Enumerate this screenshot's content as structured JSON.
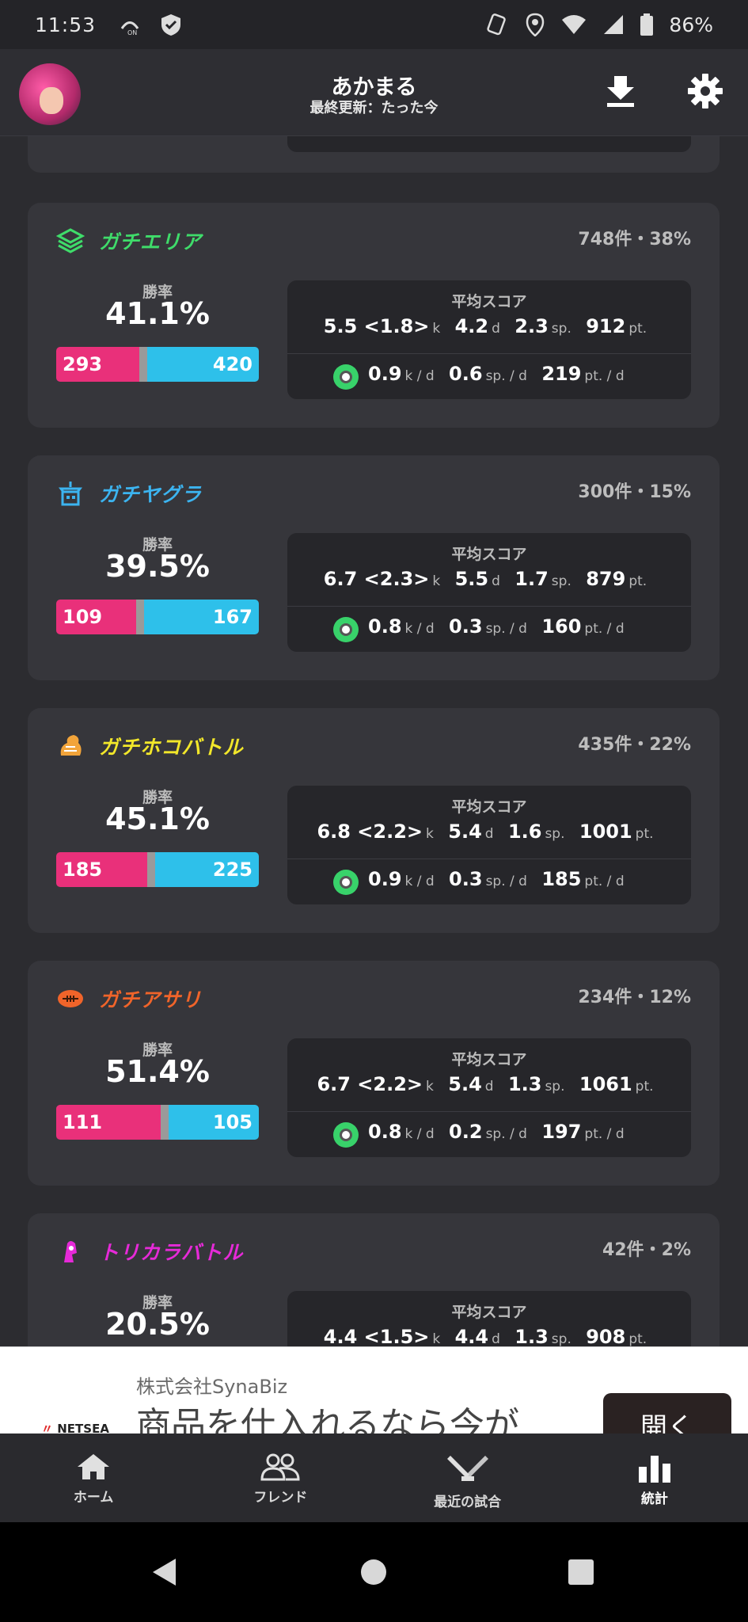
{
  "status_bar": {
    "time": "11:53",
    "battery": "86%"
  },
  "header": {
    "title": "あかまる",
    "subtitle": "最終更新：たった今"
  },
  "modes": [
    {
      "name": "ガチエリア",
      "color": "#3fdc6a",
      "count": "748件・38%",
      "win_rate_label": "勝率",
      "win_rate": "41.1%",
      "wins": "293",
      "losses": "420",
      "win_fraction": 0.411,
      "score_label": "平均スコア",
      "kill": "5.5 <1.8>",
      "death": "4.2",
      "special": "2.3",
      "points": "912",
      "kd": "0.9",
      "spd": "0.6",
      "ptd": "219"
    },
    {
      "name": "ガチヤグラ",
      "color": "#3cb4f0",
      "count": "300件・15%",
      "win_rate_label": "勝率",
      "win_rate": "39.5%",
      "wins": "109",
      "losses": "167",
      "win_fraction": 0.395,
      "score_label": "平均スコア",
      "kill": "6.7 <2.3>",
      "death": "5.5",
      "special": "1.7",
      "points": "879",
      "kd": "0.8",
      "spd": "0.3",
      "ptd": "160"
    },
    {
      "name": "ガチホコバトル",
      "color": "#f2e72a",
      "count": "435件・22%",
      "win_rate_label": "勝率",
      "win_rate": "45.1%",
      "wins": "185",
      "losses": "225",
      "win_fraction": 0.451,
      "score_label": "平均スコア",
      "kill": "6.8 <2.2>",
      "death": "5.4",
      "special": "1.6",
      "points": "1001",
      "kd": "0.9",
      "spd": "0.3",
      "ptd": "185"
    },
    {
      "name": "ガチアサリ",
      "color": "#f0642a",
      "count": "234件・12%",
      "win_rate_label": "勝率",
      "win_rate": "51.4%",
      "wins": "111",
      "losses": "105",
      "win_fraction": 0.514,
      "score_label": "平均スコア",
      "kill": "6.7 <2.2>",
      "death": "5.4",
      "special": "1.3",
      "points": "1061",
      "kd": "0.8",
      "spd": "0.2",
      "ptd": "197"
    },
    {
      "name": "トリカラバトル",
      "color": "#e62ad8",
      "count": "42件・2%",
      "win_rate_label": "勝率",
      "win_rate": "20.5%",
      "score_label": "平均スコア",
      "kill": "4.4 <1.5>",
      "death": "4.4",
      "special": "1.3",
      "points": "908"
    }
  ],
  "units": {
    "k": "k",
    "d": "d",
    "sp": "sp.",
    "pt": "pt.",
    "kd": "k / d",
    "spd": "sp. / d",
    "ptd": "pt. / d"
  },
  "ad": {
    "brand": "株式会社SynaBiz",
    "headline": "商品を仕入れるなら今が",
    "logo": "NETSEA",
    "button": "開く"
  },
  "bottom_nav": [
    {
      "label": "ホーム",
      "icon": "home-icon"
    },
    {
      "label": "フレンド",
      "icon": "friends-icon"
    },
    {
      "label": "最近の試合",
      "icon": "recent-matches-icon"
    },
    {
      "label": "統計",
      "icon": "stats-icon",
      "active": true
    }
  ]
}
